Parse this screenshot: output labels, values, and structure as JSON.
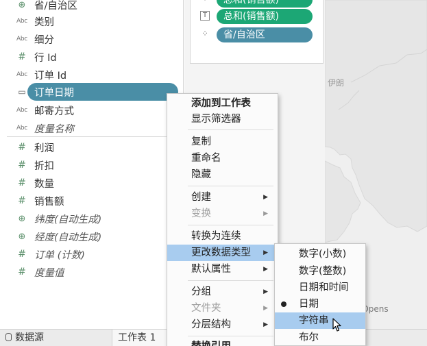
{
  "data_pane": {
    "fields": [
      {
        "icon": "globe-icon",
        "glyph": "⊕",
        "label": "省/自治区",
        "italic": false
      },
      {
        "icon": "abc-icon",
        "glyph": "Abc",
        "label": "类别",
        "italic": false
      },
      {
        "icon": "abc-icon",
        "glyph": "Abc",
        "label": "细分",
        "italic": false
      },
      {
        "icon": "hash-icon",
        "glyph": "#",
        "label": "行 Id",
        "italic": false
      },
      {
        "icon": "abc-icon",
        "glyph": "Abc",
        "label": "订单 Id",
        "italic": false
      },
      {
        "icon": "calendar-icon",
        "glyph": "▭",
        "label": "订单日期",
        "italic": false,
        "selected": true
      },
      {
        "icon": "abc-icon",
        "glyph": "Abc",
        "label": "邮寄方式",
        "italic": false
      },
      {
        "icon": "abc-icon",
        "glyph": "Abc",
        "label": "度量名称",
        "italic": true
      },
      {
        "icon": "hash-icon",
        "glyph": "#",
        "label": "利润",
        "italic": false
      },
      {
        "icon": "hash-icon",
        "glyph": "#",
        "label": "折扣",
        "italic": false
      },
      {
        "icon": "hash-icon",
        "glyph": "#",
        "label": "数量",
        "italic": false
      },
      {
        "icon": "hash-icon",
        "glyph": "#",
        "label": "销售额",
        "italic": false
      },
      {
        "icon": "globe-icon",
        "glyph": "⊕",
        "label": "纬度(自动生成)",
        "italic": true
      },
      {
        "icon": "globe-icon",
        "glyph": "⊕",
        "label": "经度(自动生成)",
        "italic": true
      },
      {
        "icon": "hash-icon",
        "glyph": "#",
        "label": "订单 (计数)",
        "italic": true
      },
      {
        "icon": "hash-icon",
        "glyph": "#",
        "label": "度量值",
        "italic": true
      }
    ]
  },
  "marks_card": {
    "rows": [
      {
        "icon": "color-icon",
        "glyph": "⁘",
        "label": "总和(销售额)",
        "color": "green"
      },
      {
        "icon": "text-icon",
        "glyph": "T",
        "label": "总和(销售额)",
        "color": "green"
      },
      {
        "icon": "detail-icon",
        "glyph": "⁘",
        "label": "省/自治区",
        "color": "blue"
      }
    ]
  },
  "map": {
    "label_country": "伊朗",
    "attribution": "apbox © Opens"
  },
  "context_menu": {
    "add_to_sheet": "添加到工作表",
    "show_filter": "显示筛选器",
    "copy": "复制",
    "rename": "重命名",
    "hide": "隐藏",
    "create": "创建",
    "transform": "变换",
    "convert_continuous": "转换为连续",
    "change_data_type": "更改数据类型",
    "default_properties": "默认属性",
    "group": "分组",
    "folder": "文件夹",
    "hierarchy": "分层结构",
    "replace_reference": "替换引用"
  },
  "submenu": {
    "number_decimal": "数字(小数)",
    "number_whole": "数字(整数)",
    "datetime": "日期和时间",
    "date": "日期",
    "string": "字符串",
    "boolean": "布尔"
  },
  "bottom_bar": {
    "data_source": "数据源",
    "sheet": "工作表 1"
  },
  "colors": {
    "pill_blue": "#4a8ea6",
    "pill_green": "#1ca775",
    "menu_highlight": "#a8ccef"
  }
}
